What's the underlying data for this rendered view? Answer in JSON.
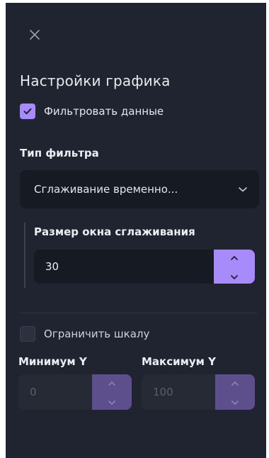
{
  "panel": {
    "title": "Настройки графика",
    "filter_checkbox": {
      "label": "Фильтровать данные",
      "checked": true
    },
    "filter_type": {
      "label": "Тип фильтра",
      "selected": "Сглаживание временно..."
    },
    "window_size": {
      "label": "Размер окна сглаживания",
      "value": "30"
    },
    "limit_scale": {
      "label": "Ограничить шкалу",
      "checked": false
    },
    "min_y": {
      "label": "Минимум Y",
      "value": "0"
    },
    "max_y": {
      "label": "Максимум Y",
      "value": "100"
    }
  },
  "icons": {
    "close": "close-icon",
    "check": "check-icon",
    "chevron": "chevron-down-icon",
    "up": "chevron-up-icon",
    "down": "chevron-down-icon"
  },
  "colors": {
    "panel_bg": "#1f2430",
    "input_bg": "#161a23",
    "accent": "#a78bfa",
    "accent_disabled": "#5d4e8c"
  }
}
